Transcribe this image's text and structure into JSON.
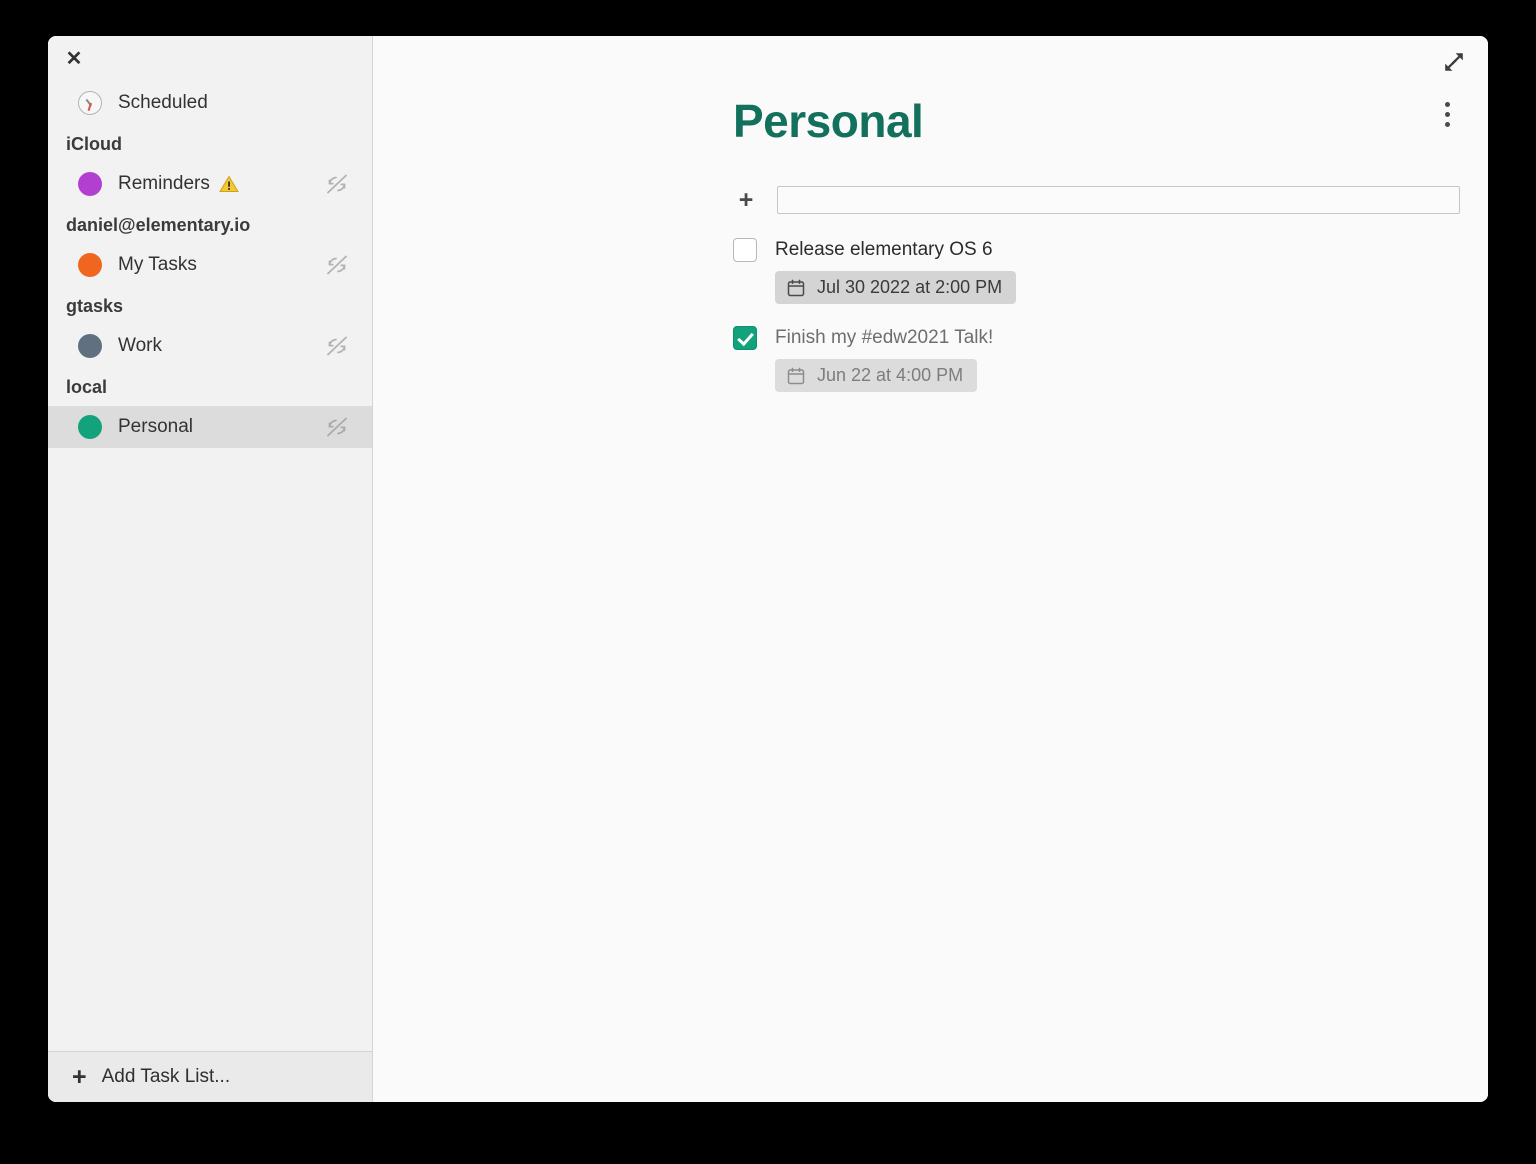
{
  "window": {
    "close_label": "✕"
  },
  "sidebar": {
    "scheduled": {
      "label": "Scheduled",
      "icon": "clock-icon"
    },
    "groups": [
      {
        "header": "iCloud",
        "items": [
          {
            "label": "Reminders",
            "color": "#b23fd0",
            "warning": true,
            "sync_disabled": true
          }
        ]
      },
      {
        "header": "daniel@elementary.io",
        "items": [
          {
            "label": "My Tasks",
            "color": "#f0661e",
            "warning": false,
            "sync_disabled": true
          }
        ]
      },
      {
        "header": "gtasks",
        "items": [
          {
            "label": "Work",
            "color": "#607080",
            "warning": false,
            "sync_disabled": true
          }
        ]
      },
      {
        "header": "local",
        "items": [
          {
            "label": "Personal",
            "color": "#12a27c",
            "warning": false,
            "sync_disabled": true,
            "selected": true
          }
        ]
      }
    ],
    "add_task_list": {
      "plus": "+",
      "label": "Add Task List..."
    }
  },
  "main": {
    "title": "Personal",
    "title_color": "#12705c",
    "expand_icon": "expand-icon",
    "menu_icon": "more-vertical-icon",
    "new_task": {
      "plus": "+",
      "value": "",
      "placeholder": ""
    },
    "tasks": [
      {
        "title": "Release elementary OS 6",
        "checked": false,
        "due": "Jul 30 2022 at 2:00 PM"
      },
      {
        "title": "Finish my #edw2021 Talk!",
        "checked": true,
        "due": "Jun 22 at 4:00 PM"
      }
    ]
  }
}
